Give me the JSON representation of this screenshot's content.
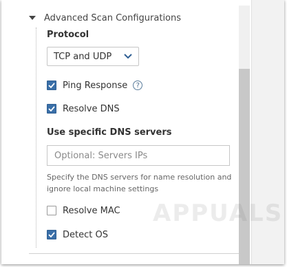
{
  "section": {
    "title": "Advanced Scan Configurations"
  },
  "protocol": {
    "label": "Protocol",
    "selected": "TCP and UDP"
  },
  "options": {
    "ping_response": {
      "label": "Ping Response",
      "checked": true,
      "help": "?"
    },
    "resolve_dns": {
      "label": "Resolve DNS",
      "checked": true
    },
    "resolve_mac": {
      "label": "Resolve MAC",
      "checked": false
    },
    "detect_os": {
      "label": "Detect OS",
      "checked": true
    }
  },
  "dns": {
    "label": "Use specific DNS servers",
    "placeholder": "Optional: Servers IPs",
    "value": "",
    "hint": "Specify the DNS servers for name resolution and ignore local machine settings"
  },
  "watermark": "APPUALS",
  "colors": {
    "checkbox_checked": "#3a6fa8",
    "scroll_thumb": "#c8c8c8"
  }
}
